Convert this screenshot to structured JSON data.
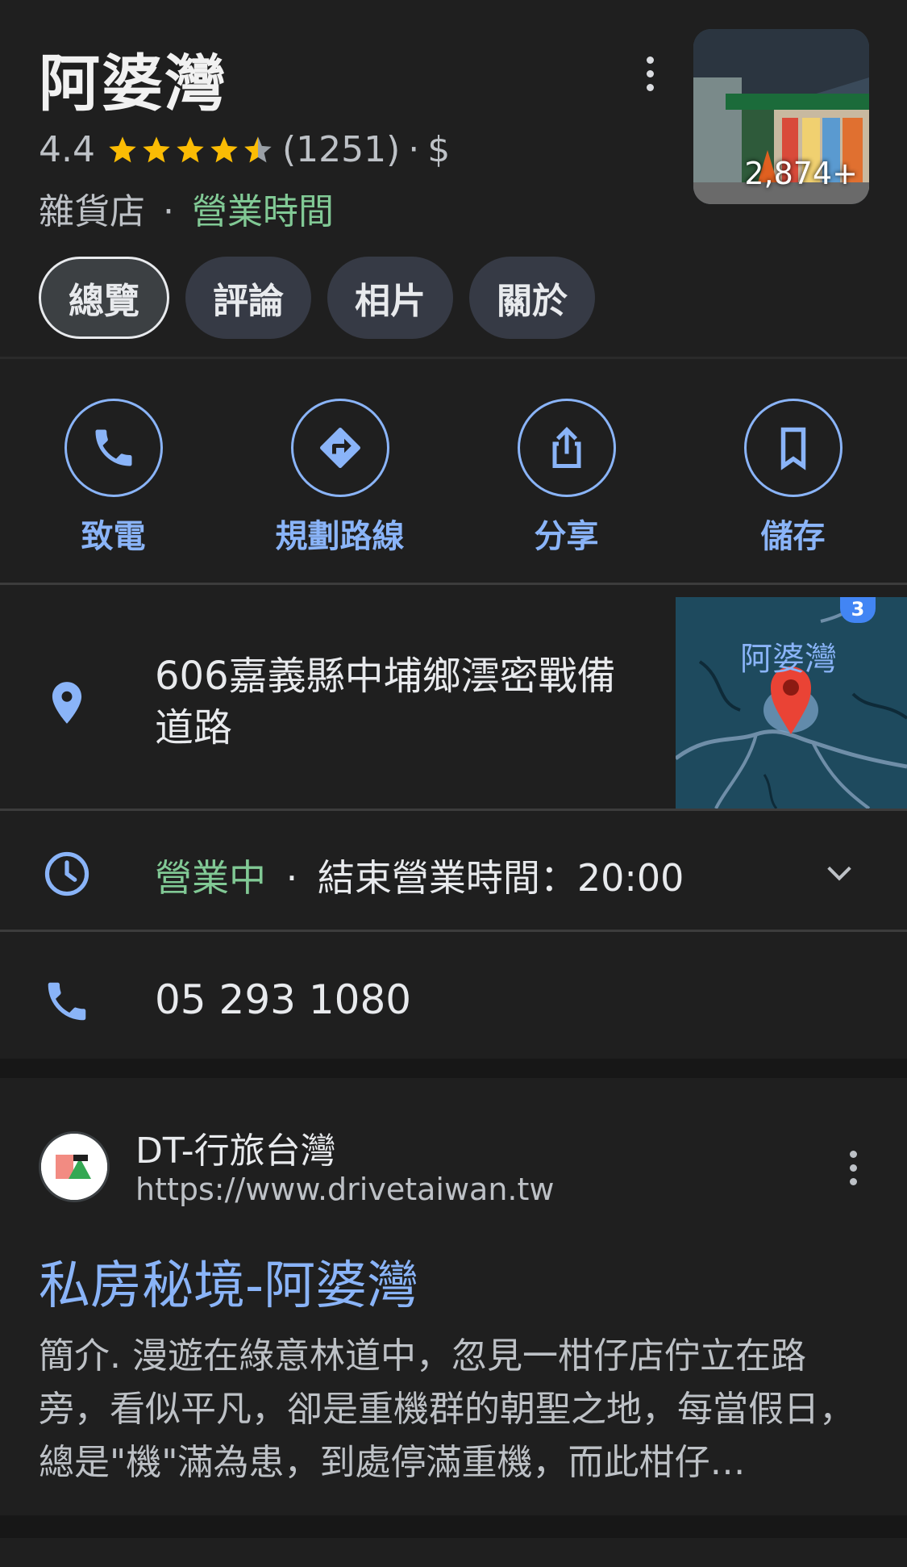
{
  "place": {
    "name": "阿婆灣",
    "rating": "4.4",
    "stars": 4.4,
    "review_count": "(1251)",
    "separator": "·",
    "price": "$",
    "category": "雜貨店",
    "hours_link": "營業時間",
    "photo_count": "2,874+"
  },
  "tabs": [
    {
      "label": "總覽",
      "active": true
    },
    {
      "label": "評論",
      "active": false
    },
    {
      "label": "相片",
      "active": false
    },
    {
      "label": "關於",
      "active": false
    }
  ],
  "actions": [
    {
      "label": "致電",
      "icon": "phone-icon"
    },
    {
      "label": "規劃路線",
      "icon": "directions-icon"
    },
    {
      "label": "分享",
      "icon": "share-icon"
    },
    {
      "label": "儲存",
      "icon": "bookmark-icon"
    }
  ],
  "address": {
    "text": "606嘉義縣中埔鄉澐密戰備道路",
    "map_label": "阿婆灣",
    "route_number": "3"
  },
  "hours": {
    "status": "營業中",
    "separator": "·",
    "closing": "結束營業時間：20:00"
  },
  "phone": {
    "number": "05 293 1080"
  },
  "search_result": {
    "source_name": "DT-行旅台灣",
    "source_url": "https://www.drivetaiwan.tw",
    "title": "私房秘境-阿婆灣",
    "snippet": "簡介. 漫遊在綠意林道中，忽見一柑仔店佇立在路旁，看似平凡，卻是重機群的朝聖之地，每當假日，總是\"機\"滿為患，到處停滿重機，而此柑仔…"
  },
  "colors": {
    "accent_blue": "#8ab4f8",
    "open_green": "#81c995",
    "star_yellow": "#fbbc04",
    "background": "#1f1f1f"
  }
}
